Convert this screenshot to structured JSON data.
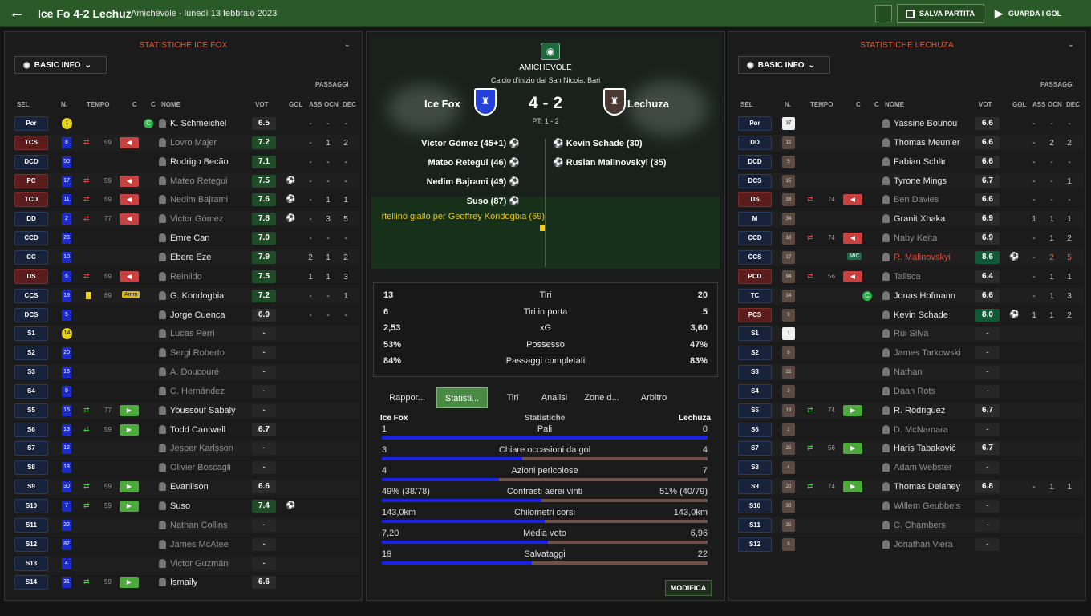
{
  "header": {
    "score_title": "Ice Fo 4-2 Lechuz",
    "subtitle": "Amichevole - lunedì 13 febbraio 2023",
    "save_label": "SALVA PARTITA",
    "watch_label": "GUARDA I GOL"
  },
  "left": {
    "title": "STATISTICHE ICE FOX",
    "filter": "BASIC INFO",
    "passes_header": "PASSAGGI",
    "columns": [
      "SEL",
      "N.",
      "TEMPO",
      "C",
      "C",
      "NOME",
      "VOT",
      "GOL",
      "ASS",
      "OCN",
      "DEC"
    ],
    "players": [
      {
        "pos": "Por",
        "num": "1",
        "gk": true,
        "name": "K. Schmeichel",
        "rating": "6.5",
        "ass": "-",
        "ocn": "-",
        "dec": "-",
        "cap": "C"
      },
      {
        "pos": "TCS",
        "num": "8",
        "out": "59",
        "name": "Lovro Majer",
        "rating": "7.2",
        "ass": "-",
        "ocn": "1",
        "dec": "2",
        "dim": true
      },
      {
        "pos": "DCD",
        "num": "50",
        "name": "Rodrigo Becão",
        "rating": "7.1",
        "ass": "-",
        "ocn": "-",
        "dec": "-"
      },
      {
        "pos": "PC",
        "num": "17",
        "out": "59",
        "name": "Mateo Retegui",
        "rating": "7.5",
        "goal": true,
        "ass": "-",
        "ocn": "-",
        "dec": "-",
        "dim": true
      },
      {
        "pos": "TCD",
        "num": "11",
        "out": "59",
        "name": "Nedim Bajrami",
        "rating": "7.6",
        "goal": true,
        "ass": "-",
        "ocn": "1",
        "dec": "1",
        "dim": true
      },
      {
        "pos": "DD",
        "num": "2",
        "out": "77",
        "name": "Victor Gómez",
        "rating": "7.8",
        "goal": true,
        "ass": "-",
        "ocn": "3",
        "dec": "5",
        "dim": true
      },
      {
        "pos": "CCD",
        "num": "23",
        "name": "Emre Can",
        "rating": "7.0",
        "ass": "-",
        "ocn": "-",
        "dec": "-"
      },
      {
        "pos": "CC",
        "num": "10",
        "name": "Ebere Eze",
        "rating": "7.9",
        "ass": "2",
        "ocn": "1",
        "dec": "2"
      },
      {
        "pos": "DS",
        "num": "6",
        "out": "59",
        "name": "Reinildo",
        "rating": "7.5",
        "ass": "1",
        "ocn": "1",
        "dec": "3",
        "dim": true
      },
      {
        "pos": "CCS",
        "num": "19",
        "yellow": true,
        "mins": "69",
        "amm": "Amm",
        "name": "G. Kondogbia",
        "rating": "7.2",
        "ass": "-",
        "ocn": "-",
        "dec": "1"
      },
      {
        "pos": "DCS",
        "num": "5",
        "name": "Jorge Cuenca",
        "rating": "6.9",
        "ass": "-",
        "ocn": "-",
        "dec": "-"
      },
      {
        "pos": "S1",
        "num": "14",
        "gk": true,
        "name": "Lucas Perri",
        "rating": "-",
        "dim": true
      },
      {
        "pos": "S2",
        "num": "20",
        "name": "Sergi Roberto",
        "rating": "-",
        "dim": true
      },
      {
        "pos": "S3",
        "num": "16",
        "name": "A. Doucouré",
        "rating": "-",
        "dim": true
      },
      {
        "pos": "S4",
        "num": "9",
        "name": "C. Hernández",
        "rating": "-",
        "dim": true
      },
      {
        "pos": "S5",
        "num": "15",
        "in": "77",
        "name": "Youssouf Sabaly",
        "rating": "-"
      },
      {
        "pos": "S6",
        "num": "13",
        "in": "59",
        "name": "Todd Cantwell",
        "rating": "6.7"
      },
      {
        "pos": "S7",
        "num": "12",
        "name": "Jesper Karlsson",
        "rating": "-",
        "dim": true
      },
      {
        "pos": "S8",
        "num": "18",
        "name": "Olivier Boscagli",
        "rating": "-",
        "dim": true
      },
      {
        "pos": "S9",
        "num": "30",
        "in": "59",
        "name": "Evanilson",
        "rating": "6.6"
      },
      {
        "pos": "S10",
        "num": "7",
        "in": "59",
        "name": "Suso",
        "rating": "7.4",
        "goal": true
      },
      {
        "pos": "S11",
        "num": "22",
        "name": "Nathan Collins",
        "rating": "-",
        "dim": true
      },
      {
        "pos": "S12",
        "num": "87",
        "name": "James McAtee",
        "rating": "-",
        "dim": true
      },
      {
        "pos": "S13",
        "num": "4",
        "name": "Victor Guzmán",
        "rating": "-",
        "dim": true
      },
      {
        "pos": "S14",
        "num": "31",
        "in": "59",
        "name": "Ismaily",
        "rating": "6.6"
      }
    ]
  },
  "right": {
    "title": "STATISTICHE LECHUZA",
    "filter": "BASIC INFO",
    "passes_header": "PASSAGGI",
    "columns": [
      "SEL",
      "N.",
      "TEMPO",
      "C",
      "C",
      "NOME",
      "VOT",
      "GOL",
      "ASS",
      "OCN",
      "DEC"
    ],
    "players": [
      {
        "pos": "Por",
        "num": "37",
        "gk": true,
        "name": "Yassine Bounou",
        "rating": "6.6",
        "ass": "-",
        "ocn": "-",
        "dec": "-"
      },
      {
        "pos": "DD",
        "num": "12",
        "name": "Thomas Meunier",
        "rating": "6.6",
        "ass": "-",
        "ocn": "2",
        "dec": "2"
      },
      {
        "pos": "DCD",
        "num": "5",
        "name": "Fabian Schär",
        "rating": "6.6",
        "ass": "-",
        "ocn": "-",
        "dec": "-"
      },
      {
        "pos": "DCS",
        "num": "15",
        "name": "Tyrone Mings",
        "rating": "6.7",
        "ass": "-",
        "ocn": "-",
        "dec": "1"
      },
      {
        "pos": "DS",
        "num": "33",
        "out": "74",
        "name": "Ben Davies",
        "rating": "6.6",
        "ass": "-",
        "ocn": "-",
        "dec": "-",
        "dim": true
      },
      {
        "pos": "M",
        "num": "34",
        "name": "Granit Xhaka",
        "rating": "6.9",
        "ass": "1",
        "ocn": "1",
        "dec": "1"
      },
      {
        "pos": "CCD",
        "num": "18",
        "out": "74",
        "name": "Naby Keïta",
        "rating": "6.9",
        "ass": "-",
        "ocn": "1",
        "dec": "2",
        "dim": true
      },
      {
        "pos": "CCS",
        "num": "17",
        "mic": "MiC",
        "name": "R. Malinovskyi",
        "rating": "8.6",
        "goal": true,
        "ass": "-",
        "ocn": "2",
        "dec": "5",
        "sel": true,
        "best": true
      },
      {
        "pos": "PCD",
        "num": "94",
        "out": "56",
        "name": "Talisca",
        "rating": "6.4",
        "ass": "-",
        "ocn": "1",
        "dec": "1",
        "dim": true
      },
      {
        "pos": "TC",
        "num": "14",
        "cap": "C",
        "name": "Jonas Hofmann",
        "rating": "6.6",
        "ass": "-",
        "ocn": "1",
        "dec": "3"
      },
      {
        "pos": "PCS",
        "num": "9",
        "name": "Kevin Schade",
        "rating": "8.0",
        "goal": true,
        "ass": "1",
        "ocn": "1",
        "dec": "2",
        "best": true
      },
      {
        "pos": "S1",
        "num": "1",
        "gk": true,
        "name": "Rui Silva",
        "rating": "-",
        "dim": true
      },
      {
        "pos": "S2",
        "num": "6",
        "name": "James Tarkowski",
        "rating": "-",
        "dim": true
      },
      {
        "pos": "S3",
        "num": "22",
        "name": "Nathan",
        "rating": "-",
        "dim": true
      },
      {
        "pos": "S4",
        "num": "3",
        "name": "Daan Rots",
        "rating": "-",
        "dim": true
      },
      {
        "pos": "S5",
        "num": "13",
        "in": "74",
        "name": "R. Rodriguez",
        "rating": "6.7"
      },
      {
        "pos": "S6",
        "num": "2",
        "name": "D. McNamara",
        "rating": "-",
        "dim": true
      },
      {
        "pos": "S7",
        "num": "25",
        "in": "56",
        "name": "Haris Tabaković",
        "rating": "6.7"
      },
      {
        "pos": "S8",
        "num": "4",
        "name": "Adam Webster",
        "rating": "-",
        "dim": true
      },
      {
        "pos": "S9",
        "num": "20",
        "in": "74",
        "name": "Thomas Delaney",
        "rating": "6.8",
        "ass": "-",
        "ocn": "1",
        "dec": "1"
      },
      {
        "pos": "S10",
        "num": "30",
        "name": "Willem Geubbels",
        "rating": "-",
        "dim": true
      },
      {
        "pos": "S11",
        "num": "35",
        "name": "C. Chambers",
        "rating": "-",
        "dim": true
      },
      {
        "pos": "S12",
        "num": "8",
        "name": "Jonathan Viera",
        "rating": "-",
        "dim": true
      }
    ]
  },
  "match": {
    "competition": "AMICHEVOLE",
    "kickoff": "Calcio d'inizio dal San Nicola, Bari",
    "home": "Ice Fox",
    "away": "Lechuza",
    "score": "4 - 2",
    "ht": "PT: 1 - 2",
    "home_goals": [
      "Víctor Gómez (45+1)",
      "Mateo Retegui (46)",
      "Nedim Bajrami (49)",
      "Suso (87)"
    ],
    "away_goals": [
      "Kevin Schade (30)",
      "Ruslan Malinovskyi (35)"
    ],
    "card_event": "rtellino giallo per Geoffrey Kondogbia (69)"
  },
  "summary_stats": [
    {
      "home": "13",
      "label": "Tiri",
      "away": "20"
    },
    {
      "home": "6",
      "label": "Tiri in porta",
      "away": "5"
    },
    {
      "home": "2,53",
      "label": "xG",
      "away": "3,60"
    },
    {
      "home": "53%",
      "label": "Possesso",
      "away": "47%"
    },
    {
      "home": "84%",
      "label": "Passaggi completati",
      "away": "83%"
    }
  ],
  "tabs": [
    "Rappor...",
    "Statisti...",
    "Tiri",
    "Analisi",
    "Zone d...",
    "Arbitro"
  ],
  "detail": {
    "home": "Ice Fox",
    "title": "Statistiche",
    "away": "Lechuza",
    "rows": [
      {
        "lv": "1",
        "label": "Pali",
        "rv": "0",
        "pct": 100
      },
      {
        "lv": "3",
        "label": "Chiare occasioni da gol",
        "rv": "4",
        "pct": 43
      },
      {
        "lv": "4",
        "label": "Azioni pericolose",
        "rv": "7",
        "pct": 36
      },
      {
        "lv": "49% (38/78)",
        "label": "Contrasti aerei vinti",
        "rv": "51% (40/79)",
        "pct": 49
      },
      {
        "lv": "143,0km",
        "label": "Chilometri corsi",
        "rv": "143,0km",
        "pct": 50
      },
      {
        "lv": "7,20",
        "label": "Media voto",
        "rv": "6,96",
        "pct": 51
      },
      {
        "lv": "19",
        "label": "Salvataggi",
        "rv": "22",
        "pct": 46
      }
    ],
    "modify_label": "MODIFICA"
  }
}
